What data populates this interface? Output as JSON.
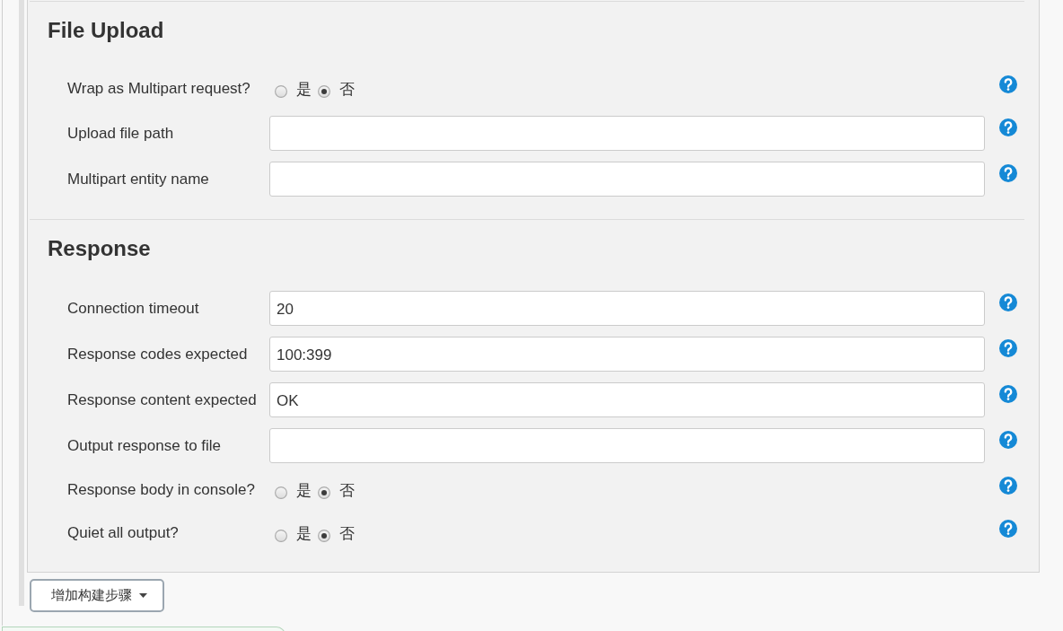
{
  "sections": [
    {
      "title": "File Upload",
      "fields": [
        {
          "kind": "radio",
          "label": "Wrap as Multipart request?",
          "options": [
            {
              "label": "是",
              "selected": false
            },
            {
              "label": "否",
              "selected": true
            }
          ]
        },
        {
          "kind": "text",
          "label": "Upload file path"
        },
        {
          "kind": "text",
          "label": "Multipart entity name"
        }
      ]
    },
    {
      "title": "Response",
      "fields": [
        {
          "kind": "text",
          "label": "Connection timeout",
          "value": "20"
        },
        {
          "kind": "text",
          "label": "Response codes expected",
          "value": "100:399"
        },
        {
          "kind": "text",
          "label": "Response content expected",
          "value": "OK"
        },
        {
          "kind": "text",
          "label": "Output response to file"
        },
        {
          "kind": "radio",
          "label": "Response body in console?",
          "options": [
            {
              "label": "是",
              "selected": false
            },
            {
              "label": "否",
              "selected": true
            }
          ]
        },
        {
          "kind": "radio",
          "label": "Quiet all output?",
          "options": [
            {
              "label": "是",
              "selected": false
            },
            {
              "label": "否",
              "selected": true
            }
          ]
        }
      ]
    }
  ],
  "add_step_button": {
    "label": "增加构建步骤"
  }
}
